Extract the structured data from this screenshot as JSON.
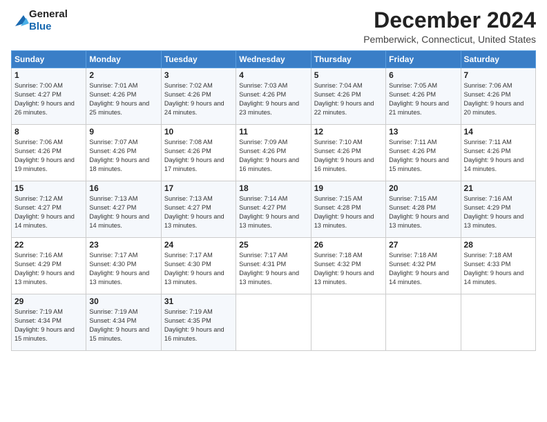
{
  "logo": {
    "line1": "General",
    "line2": "Blue"
  },
  "title": "December 2024",
  "subtitle": "Pemberwick, Connecticut, United States",
  "days_of_week": [
    "Sunday",
    "Monday",
    "Tuesday",
    "Wednesday",
    "Thursday",
    "Friday",
    "Saturday"
  ],
  "weeks": [
    [
      {
        "day": "1",
        "sunrise": "7:00 AM",
        "sunset": "4:27 PM",
        "daylight": "9 hours and 26 minutes."
      },
      {
        "day": "2",
        "sunrise": "7:01 AM",
        "sunset": "4:26 PM",
        "daylight": "9 hours and 25 minutes."
      },
      {
        "day": "3",
        "sunrise": "7:02 AM",
        "sunset": "4:26 PM",
        "daylight": "9 hours and 24 minutes."
      },
      {
        "day": "4",
        "sunrise": "7:03 AM",
        "sunset": "4:26 PM",
        "daylight": "9 hours and 23 minutes."
      },
      {
        "day": "5",
        "sunrise": "7:04 AM",
        "sunset": "4:26 PM",
        "daylight": "9 hours and 22 minutes."
      },
      {
        "day": "6",
        "sunrise": "7:05 AM",
        "sunset": "4:26 PM",
        "daylight": "9 hours and 21 minutes."
      },
      {
        "day": "7",
        "sunrise": "7:06 AM",
        "sunset": "4:26 PM",
        "daylight": "9 hours and 20 minutes."
      }
    ],
    [
      {
        "day": "8",
        "sunrise": "7:06 AM",
        "sunset": "4:26 PM",
        "daylight": "9 hours and 19 minutes."
      },
      {
        "day": "9",
        "sunrise": "7:07 AM",
        "sunset": "4:26 PM",
        "daylight": "9 hours and 18 minutes."
      },
      {
        "day": "10",
        "sunrise": "7:08 AM",
        "sunset": "4:26 PM",
        "daylight": "9 hours and 17 minutes."
      },
      {
        "day": "11",
        "sunrise": "7:09 AM",
        "sunset": "4:26 PM",
        "daylight": "9 hours and 16 minutes."
      },
      {
        "day": "12",
        "sunrise": "7:10 AM",
        "sunset": "4:26 PM",
        "daylight": "9 hours and 16 minutes."
      },
      {
        "day": "13",
        "sunrise": "7:11 AM",
        "sunset": "4:26 PM",
        "daylight": "9 hours and 15 minutes."
      },
      {
        "day": "14",
        "sunrise": "7:11 AM",
        "sunset": "4:26 PM",
        "daylight": "9 hours and 14 minutes."
      }
    ],
    [
      {
        "day": "15",
        "sunrise": "7:12 AM",
        "sunset": "4:27 PM",
        "daylight": "9 hours and 14 minutes."
      },
      {
        "day": "16",
        "sunrise": "7:13 AM",
        "sunset": "4:27 PM",
        "daylight": "9 hours and 14 minutes."
      },
      {
        "day": "17",
        "sunrise": "7:13 AM",
        "sunset": "4:27 PM",
        "daylight": "9 hours and 13 minutes."
      },
      {
        "day": "18",
        "sunrise": "7:14 AM",
        "sunset": "4:27 PM",
        "daylight": "9 hours and 13 minutes."
      },
      {
        "day": "19",
        "sunrise": "7:15 AM",
        "sunset": "4:28 PM",
        "daylight": "9 hours and 13 minutes."
      },
      {
        "day": "20",
        "sunrise": "7:15 AM",
        "sunset": "4:28 PM",
        "daylight": "9 hours and 13 minutes."
      },
      {
        "day": "21",
        "sunrise": "7:16 AM",
        "sunset": "4:29 PM",
        "daylight": "9 hours and 13 minutes."
      }
    ],
    [
      {
        "day": "22",
        "sunrise": "7:16 AM",
        "sunset": "4:29 PM",
        "daylight": "9 hours and 13 minutes."
      },
      {
        "day": "23",
        "sunrise": "7:17 AM",
        "sunset": "4:30 PM",
        "daylight": "9 hours and 13 minutes."
      },
      {
        "day": "24",
        "sunrise": "7:17 AM",
        "sunset": "4:30 PM",
        "daylight": "9 hours and 13 minutes."
      },
      {
        "day": "25",
        "sunrise": "7:17 AM",
        "sunset": "4:31 PM",
        "daylight": "9 hours and 13 minutes."
      },
      {
        "day": "26",
        "sunrise": "7:18 AM",
        "sunset": "4:32 PM",
        "daylight": "9 hours and 13 minutes."
      },
      {
        "day": "27",
        "sunrise": "7:18 AM",
        "sunset": "4:32 PM",
        "daylight": "9 hours and 14 minutes."
      },
      {
        "day": "28",
        "sunrise": "7:18 AM",
        "sunset": "4:33 PM",
        "daylight": "9 hours and 14 minutes."
      }
    ],
    [
      {
        "day": "29",
        "sunrise": "7:19 AM",
        "sunset": "4:34 PM",
        "daylight": "9 hours and 15 minutes."
      },
      {
        "day": "30",
        "sunrise": "7:19 AM",
        "sunset": "4:34 PM",
        "daylight": "9 hours and 15 minutes."
      },
      {
        "day": "31",
        "sunrise": "7:19 AM",
        "sunset": "4:35 PM",
        "daylight": "9 hours and 16 minutes."
      },
      null,
      null,
      null,
      null
    ]
  ],
  "labels": {
    "sunrise": "Sunrise:",
    "sunset": "Sunset:",
    "daylight": "Daylight:"
  }
}
